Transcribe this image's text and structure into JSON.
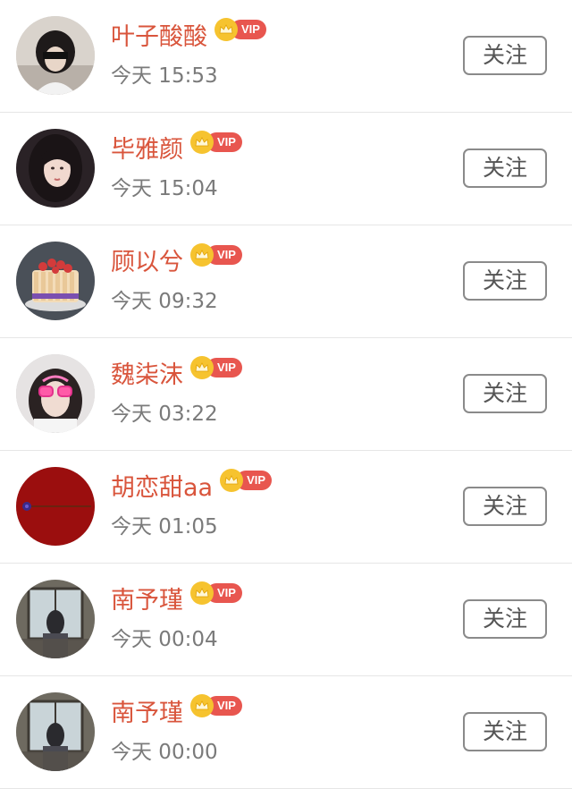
{
  "follow_label": "关注",
  "vip_label": "VIP",
  "colors": {
    "name": "#d9553c",
    "vip_pill": "#e8564f",
    "vip_crown": "#f6c32f",
    "time": "#7a7a7a"
  },
  "users": [
    {
      "name": "叶子酸酸",
      "time": "今天 15:53",
      "avatar": "girl-mask-avatar"
    },
    {
      "name": "毕雅颜",
      "time": "今天 15:04",
      "avatar": "girl-portrait-avatar"
    },
    {
      "name": "顾以兮",
      "time": "今天 09:32",
      "avatar": "cake-avatar"
    },
    {
      "name": "魏柒沫",
      "time": "今天 03:22",
      "avatar": "girl-glasses-avatar"
    },
    {
      "name": "胡恋甜aa",
      "time": "今天 01:05",
      "avatar": "red-rose-avatar"
    },
    {
      "name": "南予瑾",
      "time": "今天 00:04",
      "avatar": "window-girl-avatar"
    },
    {
      "name": "南予瑾",
      "time": "今天 00:00",
      "avatar": "window-girl-avatar"
    }
  ]
}
